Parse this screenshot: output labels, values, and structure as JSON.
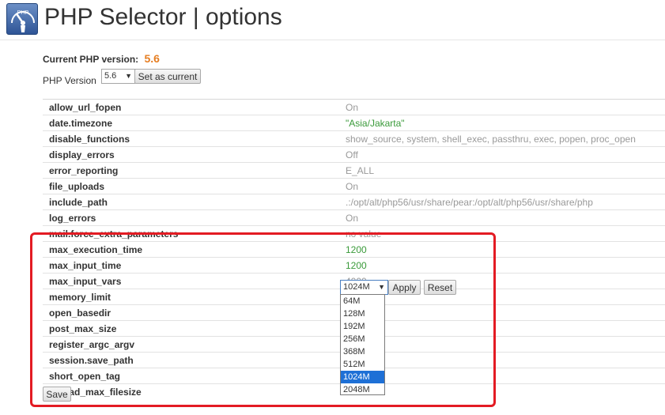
{
  "header": {
    "title": "PHP Selector | options",
    "icon_text": "PHP"
  },
  "current_version": {
    "label": "Current PHP version:",
    "value": "5.6"
  },
  "version_selector": {
    "label": "PHP Version",
    "selected": "5.6",
    "set_button": "Set as current"
  },
  "options": [
    {
      "name": "allow_url_fopen",
      "value": "On",
      "style": "gray"
    },
    {
      "name": "date.timezone",
      "value": "\"Asia/Jakarta\"",
      "style": "green"
    },
    {
      "name": "disable_functions",
      "value": "show_source, system, shell_exec, passthru, exec, popen, proc_open",
      "style": "gray"
    },
    {
      "name": "display_errors",
      "value": "Off",
      "style": "gray"
    },
    {
      "name": "error_reporting",
      "value": "E_ALL",
      "style": "gray"
    },
    {
      "name": "file_uploads",
      "value": "On",
      "style": "gray"
    },
    {
      "name": "include_path",
      "value": ".:/opt/alt/php56/usr/share/pear:/opt/alt/php56/usr/share/php",
      "style": "gray"
    },
    {
      "name": "log_errors",
      "value": "On",
      "style": "gray"
    },
    {
      "name": "mail.force_extra_parameters",
      "value": "no value",
      "style": "gray"
    },
    {
      "name": "max_execution_time",
      "value": "1200",
      "style": "green"
    },
    {
      "name": "max_input_time",
      "value": "1200",
      "style": "green"
    },
    {
      "name": "max_input_vars",
      "value": "4000",
      "style": "gray"
    },
    {
      "name": "memory_limit",
      "value": "",
      "style": "gray"
    },
    {
      "name": "open_basedir",
      "value": "",
      "style": "gray"
    },
    {
      "name": "post_max_size",
      "value": "",
      "style": "gray"
    },
    {
      "name": "register_argc_argv",
      "value": "",
      "style": "gray"
    },
    {
      "name": "session.save_path",
      "value": "",
      "style": "gray"
    },
    {
      "name": "short_open_tag",
      "value": "",
      "style": "gray"
    },
    {
      "name": "upload_max_filesize",
      "value": "",
      "style": "gray"
    }
  ],
  "memory_limit_editor": {
    "selected": "1024M",
    "apply_label": "Apply",
    "reset_label": "Reset",
    "dropdown_options": [
      "64M",
      "128M",
      "192M",
      "256M",
      "368M",
      "512M",
      "1024M",
      "2048M"
    ]
  },
  "save_label": "Save",
  "colors": {
    "accent_orange": "#e67e22",
    "value_green": "#3a9a3a",
    "highlight_red": "#e31b23",
    "selection_blue": "#1e70d6"
  }
}
